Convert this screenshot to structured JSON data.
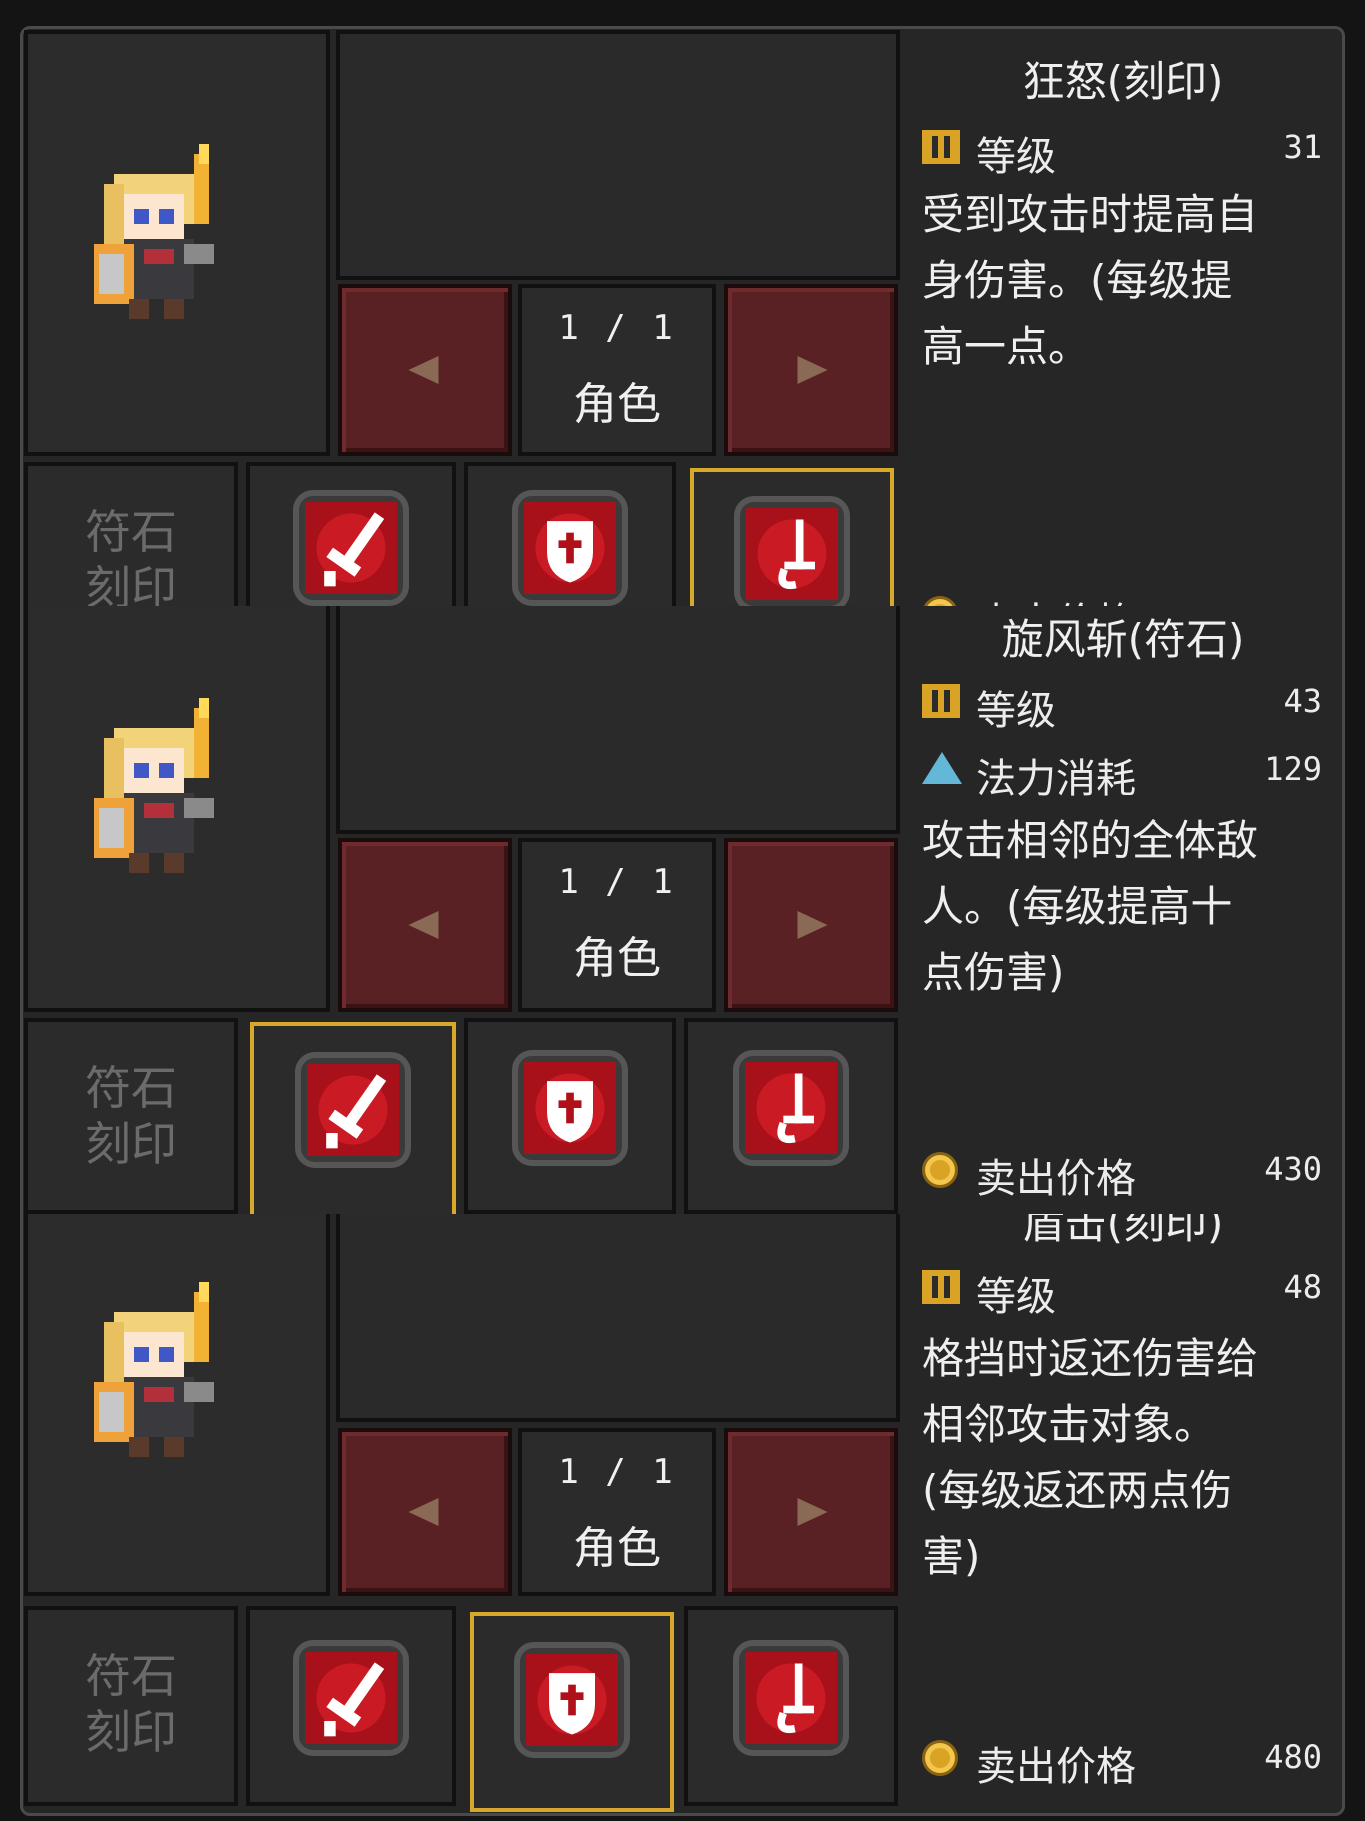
{
  "panels": [
    {
      "pager": {
        "page": "1 / 1",
        "label": "角色"
      },
      "side_label": "符石\n刻印",
      "selected_slot": 3,
      "slots": [
        "sword-rune-icon",
        "shield-rune-icon",
        "rapier-rune-icon"
      ],
      "detail": {
        "title": "狂怒(刻印)",
        "level_label": "等级",
        "level_value": "31",
        "description": [
          "受到攻击时提高自",
          "身伤害。(每级提",
          "高一点。"
        ],
        "price_label": "卖出价格",
        "price_value": ""
      }
    },
    {
      "pager": {
        "page": "1 / 1",
        "label": "角色"
      },
      "side_label": "符石\n刻印",
      "selected_slot": 1,
      "slots": [
        "sword-rune-icon",
        "shield-rune-icon",
        "rapier-rune-icon"
      ],
      "detail": {
        "title": "旋风斩(符石)",
        "level_label": "等级",
        "level_value": "43",
        "mana_label": "法力消耗",
        "mana_value": "129",
        "description": [
          "攻击相邻的全体敌",
          "人。(每级提高十",
          "点伤害)"
        ],
        "price_label": "卖出价格",
        "price_value": "430"
      }
    },
    {
      "pager": {
        "page": "1 / 1",
        "label": "角色"
      },
      "side_label": "符石\n刻印",
      "selected_slot": 2,
      "slots": [
        "sword-rune-icon",
        "shield-rune-icon",
        "rapier-rune-icon"
      ],
      "detail": {
        "title": "盾击(刻印)",
        "level_label": "等级",
        "level_value": "48",
        "description": [
          "格挡时返还伤害给",
          "相邻攻击对象。",
          "(每级返还两点伤",
          "害)"
        ],
        "price_label": "卖出价格",
        "price_value": "480"
      }
    }
  ],
  "colors": {
    "selected_border": "#d8a82a",
    "nav_button": "#5a2124",
    "rune_red": "#c8141c",
    "gold": "#d9a425",
    "mana": "#63b8d8"
  }
}
